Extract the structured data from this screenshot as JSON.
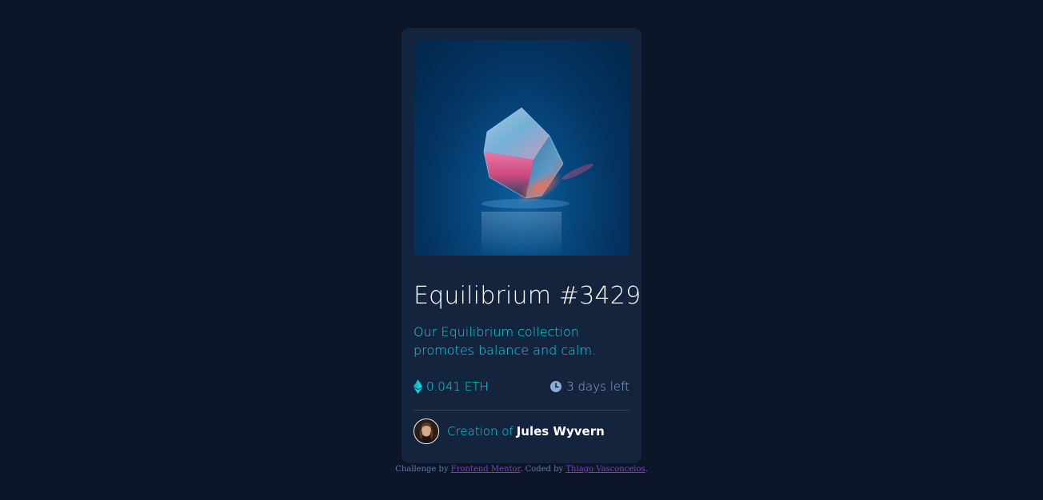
{
  "card": {
    "title": "Equilibrium #3429",
    "description": "Our Equilibrium collection promotes balance and calm.",
    "price": "0.041 ETH",
    "time_left": "3 days left",
    "creator_prefix": "Creation of",
    "creator_name": "Jules Wyvern",
    "icons": {
      "price": "ethereum-icon",
      "time": "clock-icon"
    }
  },
  "attribution": {
    "prefix": "Challenge by",
    "challenge_link": "Frontend Mentor",
    "middle": ". Coded by",
    "author_link": "Thiago Vasconcelos",
    "suffix": "."
  },
  "colors": {
    "page_background": "#0d1628",
    "card_background": "#15243d",
    "accent_cyan": "#00d7e6",
    "soft_blue": "#8bacd9",
    "white": "#ffffff",
    "link_purple": "#7b3fc9"
  }
}
